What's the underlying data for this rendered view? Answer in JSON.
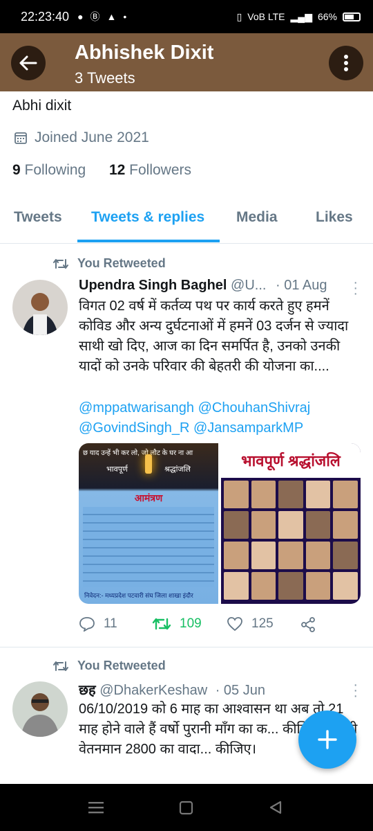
{
  "status": {
    "time": "22:23:40",
    "icons_left": [
      "spotify-icon",
      "b-icon",
      "app-icon",
      "dot-icon"
    ],
    "network": "VoB LTE",
    "battery": "66%"
  },
  "header": {
    "title": "Abhishek Dixit",
    "subtitle": "3 Tweets"
  },
  "profile": {
    "name": "Abhi dixit",
    "joined": "Joined June 2021",
    "following_count": "9",
    "following_label": "Following",
    "followers_count": "12",
    "followers_label": "Followers"
  },
  "tabs": [
    "Tweets",
    "Tweets & replies",
    "Media",
    "Likes"
  ],
  "active_tab": "Tweets & replies",
  "tweets": [
    {
      "retweet_label": "You Retweeted",
      "author_name": "Upendra Singh Baghel",
      "handle": "@U...",
      "date": "· 01 Aug",
      "text": "विगत 02 वर्ष में कर्तव्य पथ पर कार्य करते हुए हमनें कोविड और अन्य दुर्घटनाओं में हमनें 03 दर्जन से ज्यादा साथी खो दिए, आज का दिन समर्पित है, उनको उनकी यादों को उनके परिवार की बेहतरी की योजना का....",
      "mentions": "@mppatwarisangh @ChouhanShivraj @GovindSingh_R @JansamparkMP",
      "media_left": {
        "header": "छ याद उन्हें भी कर लो, जो लौट के घर ना आ",
        "label1": "भावपूर्ण",
        "label2": "श्रद्धांजलि",
        "invite": "आमंत्रण",
        "footer": "निवेदन:- मध्यप्रदेश पटवारी संघ जिला शाखा इंदौर"
      },
      "media_right_title": "भावपूर्ण श्रद्धांजलि",
      "replies": "11",
      "retweets": "109",
      "likes": "125"
    },
    {
      "retweet_label": "You Retweeted",
      "author_name": "छह",
      "handle": "@DhakerKeshaw",
      "date": "· 05 Jun",
      "text": "06/10/2019 को 6 माह का आश्वासन था अब तो 21 माह होने वाले हैं वर्षो पुरानी माँग का क... कीजिए पटवारी वेतनमान 2800 का वादा... कीजिए।"
    }
  ],
  "colors": {
    "header_bg": "#7b5a3d",
    "accent": "#1da1f2",
    "retweet_green": "#17bf63",
    "muted": "#657786"
  }
}
